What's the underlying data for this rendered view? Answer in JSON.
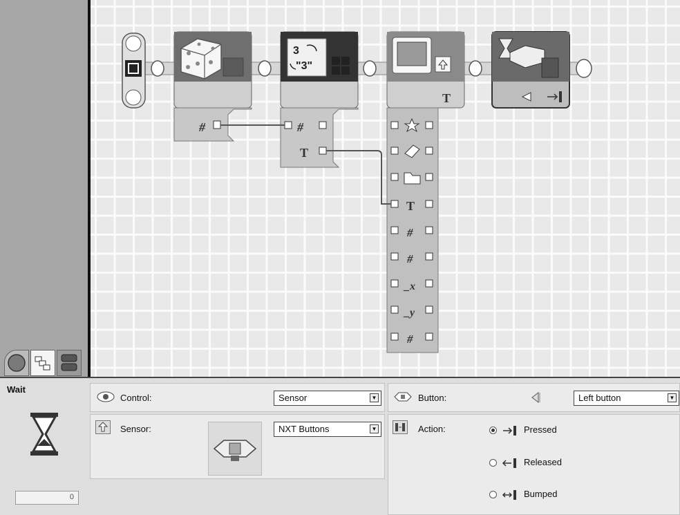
{
  "properties": {
    "block_name": "Wait",
    "counter_value": "0",
    "control_label": "Control:",
    "control_value": "Sensor",
    "sensor_label": "Sensor:",
    "sensor_value": "NXT Buttons",
    "button_label": "Button:",
    "button_value": "Left button",
    "action_label": "Action:",
    "actions": [
      {
        "label": "Pressed",
        "selected": true
      },
      {
        "label": "Released",
        "selected": false
      },
      {
        "label": "Bumped",
        "selected": false
      }
    ]
  },
  "canvas": {
    "random_block": {
      "icon": "dice-icon",
      "output_symbol": "#"
    },
    "number_to_text_block": {
      "icon_top": "3",
      "icon_bottom": "\"3\"",
      "symbols": [
        "#",
        "T"
      ]
    },
    "display_block": {
      "header_symbol": "T",
      "plug_icons": [
        "star-icon",
        "eraser-icon",
        "folder-icon",
        "T",
        "#",
        "#",
        "_x",
        "_y",
        "#"
      ]
    },
    "wait_block": {
      "icon": "hourglass-icon"
    }
  },
  "palette_tabs": [
    "common-palette-tab",
    "complete-palette-tab",
    "custom-palette-tab"
  ],
  "colors": {
    "grid_bg": "#e9e9e9",
    "block_dark": "#6f6f6f",
    "block_light": "#cfcfcf",
    "panel_bg": "#dedede"
  }
}
